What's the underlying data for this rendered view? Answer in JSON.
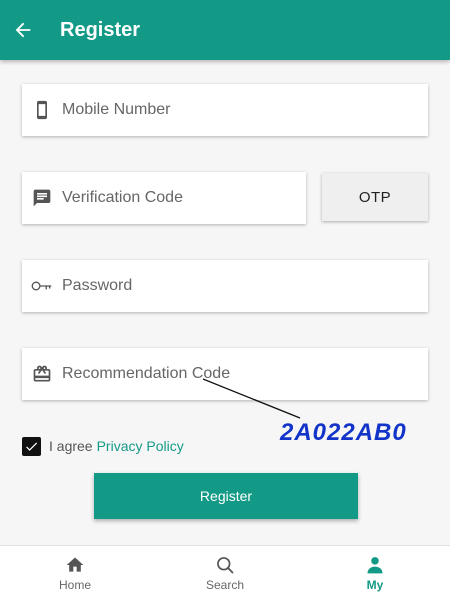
{
  "appbar": {
    "title": "Register",
    "back_icon": "arrow-left-icon"
  },
  "form": {
    "mobile": {
      "placeholder": "Mobile Number",
      "value": "",
      "icon": "phone-icon"
    },
    "verification": {
      "placeholder": "Verification Code",
      "value": "",
      "icon": "message-icon"
    },
    "otp_label": "OTP",
    "password": {
      "placeholder": "Password",
      "value": "",
      "icon": "key-icon"
    },
    "recommendation": {
      "placeholder": "Recommendation Code",
      "value": "",
      "icon": "gift-icon"
    },
    "agree": {
      "checked": true,
      "text": "I agree",
      "link": "Privacy Policy"
    },
    "register_label": "Register"
  },
  "annotation": {
    "text": "2A022AB0"
  },
  "bottom_nav": {
    "items": [
      {
        "label": "Home",
        "icon": "home-icon",
        "active": false
      },
      {
        "label": "Search",
        "icon": "search-icon",
        "active": false
      },
      {
        "label": "My",
        "icon": "person-icon",
        "active": true
      }
    ]
  },
  "colors": {
    "primary": "#139a86",
    "annotation": "#1234c8",
    "background": "#f6f6f6"
  }
}
